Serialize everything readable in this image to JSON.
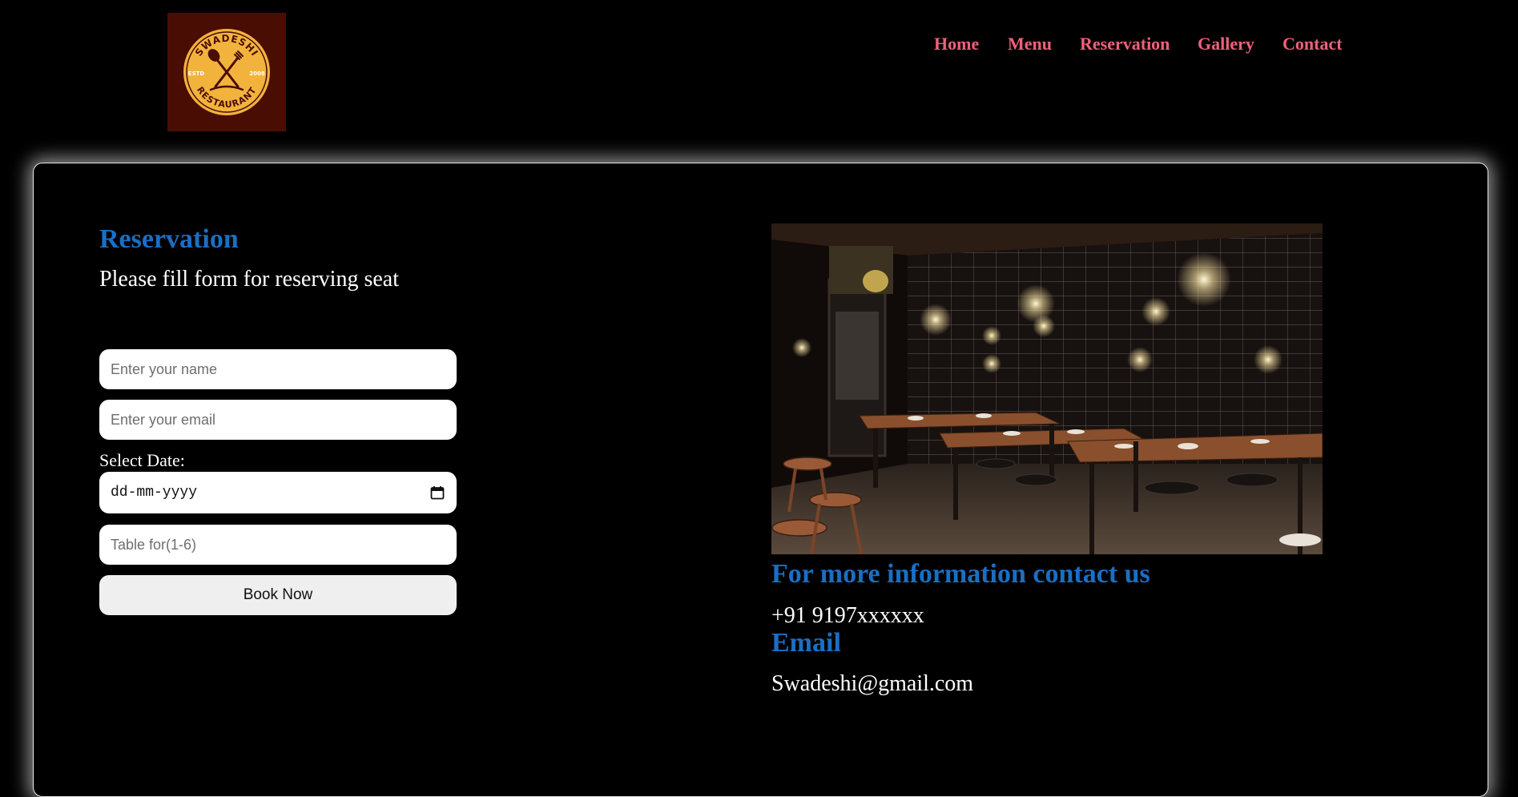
{
  "logo": {
    "top_text": "SWADESHI",
    "bottom_text": "RESTAURANT",
    "left_text": "ESTD",
    "right_text": "2008"
  },
  "nav": {
    "items": [
      "Home",
      "Menu",
      "Reservation",
      "Gallery",
      "Contact"
    ]
  },
  "reservation": {
    "title": "Reservation",
    "subtitle": "Please fill form for reserving seat",
    "name_placeholder": "Enter your name",
    "email_placeholder": "Enter your email",
    "date_label": "Select Date:",
    "date_value": "dd-mm-yyyy",
    "table_placeholder": "Table for(1-6)",
    "button_label": "Book Now"
  },
  "contact": {
    "heading": "For more information contact us",
    "phone": "+91 9197xxxxxx",
    "email_heading": "Email",
    "email": "Swadeshi@gmail.com"
  },
  "colors": {
    "background": "#000000",
    "nav_link": "#f0607a",
    "heading_blue": "#1a6fc4",
    "logo_bg": "#4a0d04",
    "logo_gold": "#f2b33d"
  }
}
